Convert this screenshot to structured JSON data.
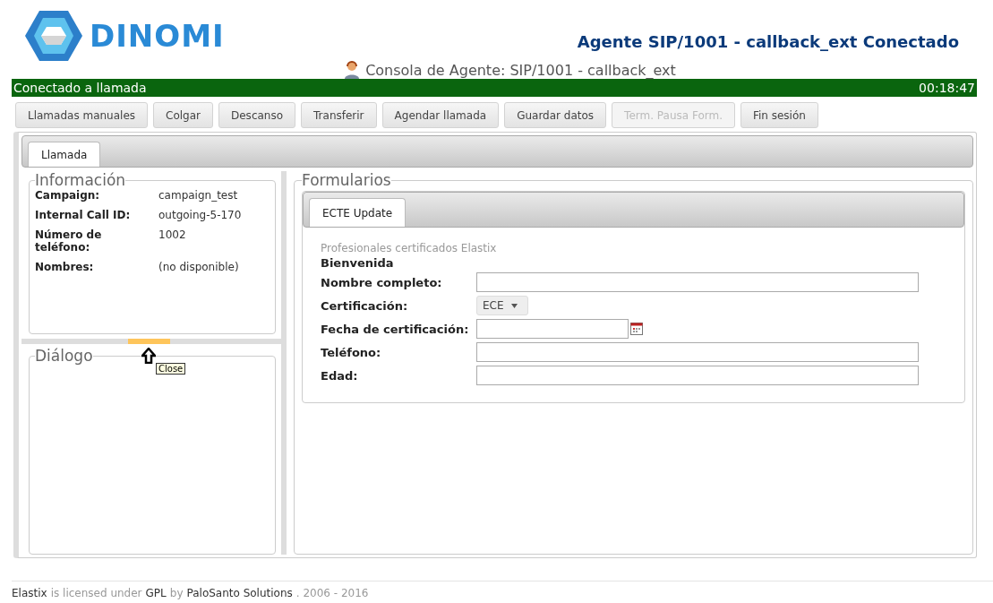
{
  "header": {
    "logo": "DINOMI",
    "agent_status": "Agente SIP/1001 - callback_ext Conectado",
    "console_title": "Consola de Agente: SIP/1001 - callback_ext"
  },
  "status_bar": {
    "text": "Conectado a llamada",
    "timer": "00:18:47"
  },
  "buttons": [
    {
      "label": "Llamadas manuales",
      "disabled": false
    },
    {
      "label": "Colgar",
      "disabled": false
    },
    {
      "label": "Descanso",
      "disabled": false
    },
    {
      "label": "Transferir",
      "disabled": false
    },
    {
      "label": "Agendar llamada",
      "disabled": false
    },
    {
      "label": "Guardar datos",
      "disabled": false
    },
    {
      "label": "Term. Pausa Form.",
      "disabled": true
    },
    {
      "label": "Fin sesión",
      "disabled": false
    }
  ],
  "tabs": [
    {
      "label": "Llamada",
      "selected": true
    }
  ],
  "info": {
    "title": "Información",
    "rows": [
      {
        "label": "Campaign:",
        "value": "campaign_test"
      },
      {
        "label": "Internal Call ID:",
        "value": "outgoing-5-170"
      },
      {
        "label": "Número de teléfono:",
        "value": "1002"
      },
      {
        "label": "Nombres:",
        "value": "(no disponible)"
      }
    ]
  },
  "splitter": {
    "tooltip": "Close"
  },
  "dialog": {
    "title": "Diálogo"
  },
  "forms": {
    "title": "Formularios",
    "tabs": [
      {
        "label": "ECTE Update",
        "selected": true
      }
    ],
    "subtitle": "Profesionales certificados Elastix",
    "heading": "Bienvenida",
    "fields": [
      {
        "label": "Nombre completo:",
        "kind": "text"
      },
      {
        "label": "Certificación:",
        "kind": "select",
        "value": "ECE"
      },
      {
        "label": "Fecha de certificación:",
        "kind": "date"
      },
      {
        "label": "Teléfono:",
        "kind": "text"
      },
      {
        "label": "Edad:",
        "kind": "text"
      }
    ]
  },
  "footer": [
    {
      "text": "Elastix",
      "kind": "link"
    },
    {
      "text": "is licensed under",
      "kind": "plain"
    },
    {
      "text": "GPL",
      "kind": "link"
    },
    {
      "text": "by",
      "kind": "plain"
    },
    {
      "text": "PaloSanto Solutions",
      "kind": "link"
    },
    {
      "text": ". 2006 - 2016",
      "kind": "plain"
    }
  ]
}
